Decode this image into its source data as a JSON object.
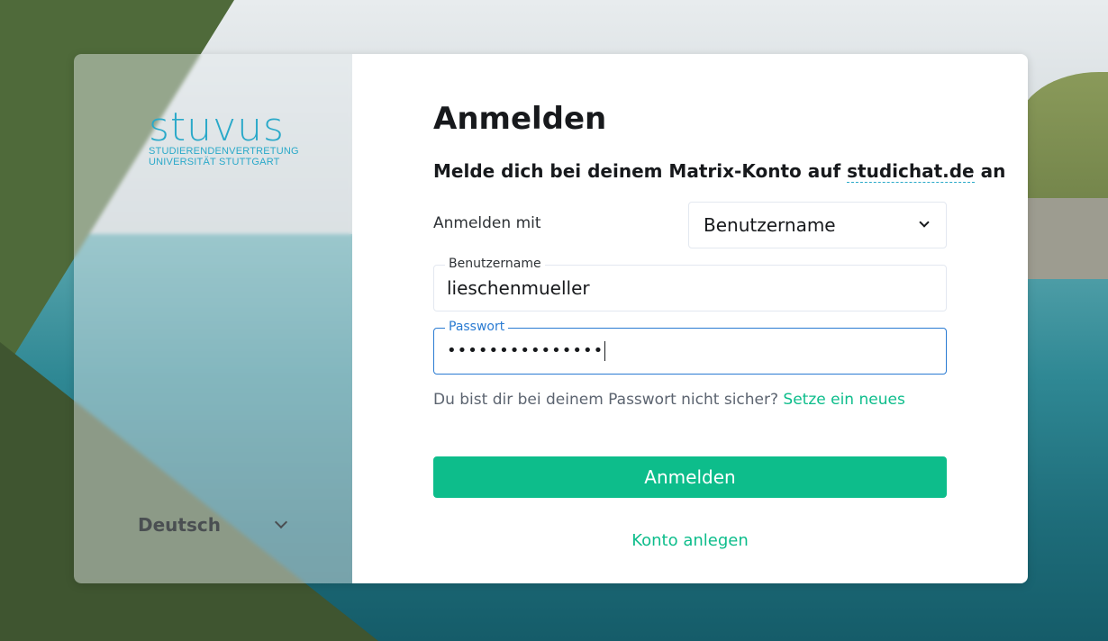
{
  "logo": {
    "word": "stuvus",
    "sub1": "STUDIERENDENVERTRETUNG",
    "sub2": "UNIVERSITÄT STUTTGART"
  },
  "language": {
    "selected": "Deutsch"
  },
  "login": {
    "title": "Anmelden",
    "subtitle_prefix": "Melde dich bei deinem Matrix-Konto auf ",
    "server": "studichat.de",
    "subtitle_suffix": " an",
    "login_with_label": "Anmelden mit",
    "login_with_value": "Benutzername",
    "username_label": "Benutzername",
    "username_value": "lieschenmueller",
    "password_label": "Passwort",
    "password_value": "•••••••••••••••",
    "forgot_text": "Du bist dir bei deinem Passwort nicht sicher? ",
    "forgot_link": "Setze ein neues",
    "submit_label": "Anmelden",
    "create_account": "Konto anlegen"
  },
  "colors": {
    "accent": "#0dbd8b",
    "focus": "#2a7bd2",
    "logo": "#2aa9c9"
  }
}
